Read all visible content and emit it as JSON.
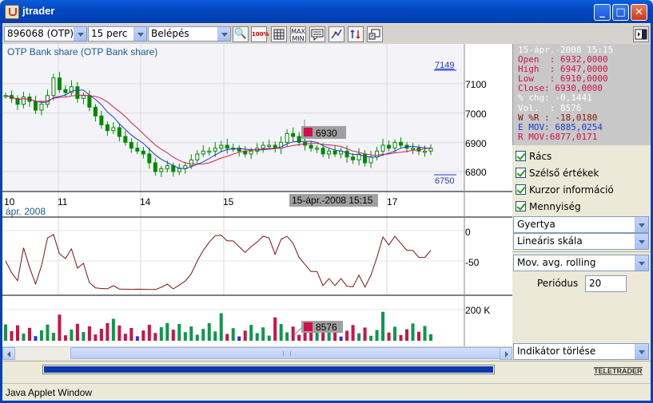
{
  "window": {
    "title": "jtrader"
  },
  "toolbar": {
    "symbol": "896068 (OTP)",
    "interval": "15 perc",
    "mode": "Belépés",
    "zoom100": "100%",
    "maxmin": "MAX MIN"
  },
  "chart": {
    "title": "OTP Bank share (OTP Bank share)",
    "price_top_label": "7149",
    "price_bottom_label": "6750",
    "price_ticks": [
      "7100",
      "7000",
      "6900",
      "6800"
    ],
    "date_ticks": [
      "10",
      "11",
      "14",
      "15",
      "17"
    ],
    "cursor_date": "15-ápr.-2008 15:15",
    "cursor_price_tag": "6930",
    "indicator_label": "ápr. 2008",
    "indicator_ticks": [
      "0",
      "-50"
    ],
    "volume_tick": "200 K",
    "volume_tag": "8576",
    "colors": {
      "sma_short": "#1a3ad0",
      "sma_long": "#d0204a",
      "candle": "#008a00",
      "williams": "#8a1010",
      "vol_up": "#0a9a4a",
      "vol_down": "#d0104a",
      "vol_mark": "#3a2ad8"
    }
  },
  "chart_data": {
    "type": "candlestick",
    "x_label_days": [
      "10",
      "11",
      "14",
      "15",
      "17"
    ],
    "price_range": [
      6750,
      7149
    ],
    "close_series": [
      7060,
      7050,
      7030,
      7055,
      7040,
      7010,
      7030,
      7060,
      7120,
      7080,
      7070,
      7090,
      7050,
      7060,
      7020,
      6990,
      6960,
      6940,
      6950,
      6920,
      6900,
      6880,
      6870,
      6860,
      6830,
      6800,
      6810,
      6820,
      6800,
      6810,
      6820,
      6840,
      6860,
      6870,
      6870,
      6880,
      6890,
      6880,
      6880,
      6870,
      6860,
      6870,
      6880,
      6890,
      6890,
      6880,
      6900,
      6930,
      6920,
      6900,
      6890,
      6880,
      6880,
      6860,
      6870,
      6860,
      6870,
      6850,
      6840,
      6860,
      6830,
      6850,
      6870,
      6890,
      6880,
      6900,
      6890,
      6880,
      6880,
      6870,
      6870,
      6880
    ],
    "williams_r_ticks": [
      0,
      -50
    ],
    "volume_tick": "200 K"
  },
  "cursor_info": {
    "date": "15-ápr.-2008 15:15",
    "open": "Open  : 6932,0000",
    "high": "High  : 6947,0000",
    "low": "Low   : 6910,0000",
    "close": "Close: 6930,0000",
    "chg": "% chg: -0,1441",
    "vol": "Vol.  : 8576",
    "wr": "W %R : -18,0180",
    "emov": "E MOV: 6885,0254",
    "rmov": "R MOV:6877,0171"
  },
  "options": {
    "racs": "Rács",
    "szelso": "Szélső értékek",
    "kurzor": "Kurzor információ",
    "mennyiseg": "Mennyiség"
  },
  "controls": {
    "chart_type": "Gyertya",
    "scale": "Lineáris skála",
    "indicator": "Mov. avg. rolling",
    "period_label": "Periódus",
    "period_value": "20",
    "remove_indicator": "Indikátor törlése"
  },
  "progress": {
    "fraction": 1.0
  },
  "footer": {
    "brand": "TELETRADER",
    "status": "Java Applet Window"
  }
}
